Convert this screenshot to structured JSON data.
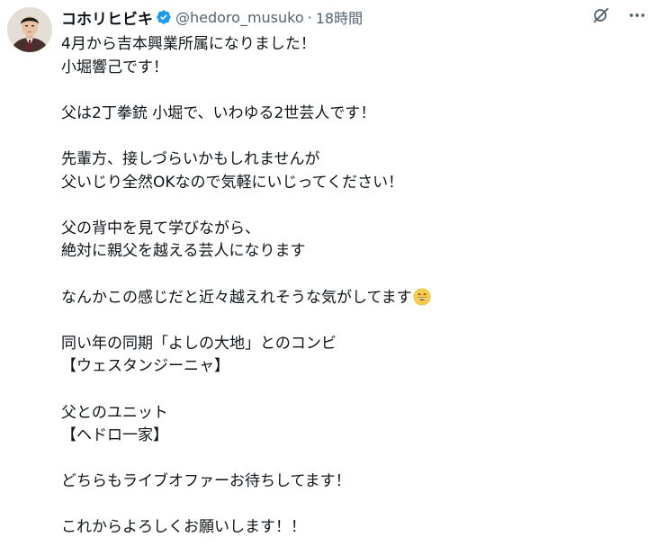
{
  "user": {
    "display_name": "コホリヒビキ",
    "handle": "@hedoro_musuko",
    "separator": "·",
    "timestamp": "18時間"
  },
  "actions": [
    "grok-icon",
    "more-icon"
  ],
  "tweet": {
    "lines": [
      "4月から吉本興業所属になりました！",
      "小堀響己です！",
      "",
      "父は2丁拳銃 小堀で、いわゆる2世芸人です！",
      "",
      "先輩方、接しづらいかもしれませんが",
      "父いじり全然OKなので気軽にいじってください！",
      "",
      "父の背中を見て学びながら、",
      "絶対に親父を越える芸人になります",
      "",
      "なんかこの感じだと近々越えれそうな気がしてます",
      "",
      "同い年の同期「よしの大地」とのコンビ",
      "【ウェスタンジーニャ】",
      "",
      "父とのユニット",
      "【ヘドロ一家】",
      "",
      "どちらもライブオファーお待ちしてます！",
      "",
      "これからよろしくお願いします！！"
    ],
    "emoji": "grinning-face-emoji"
  },
  "colors": {
    "text": "#0f1419",
    "secondary": "#536471",
    "verified": "#1d9bf0"
  }
}
